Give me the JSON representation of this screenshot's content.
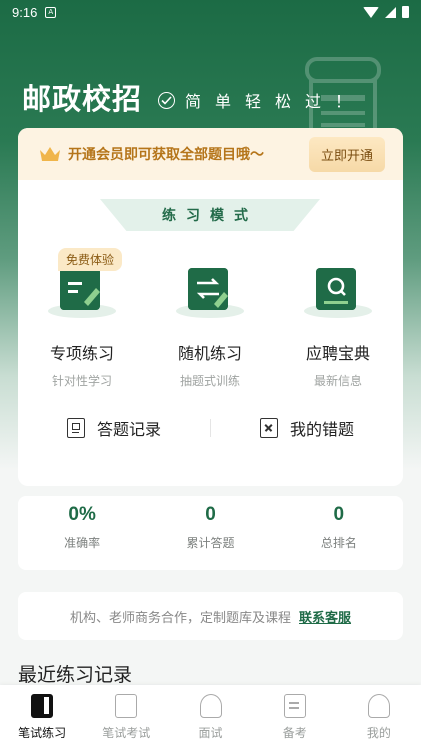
{
  "status_bar": {
    "time": "9:16",
    "notif": "A"
  },
  "header": {
    "brand": "邮政校招",
    "slogan": "简单轻松过！"
  },
  "vip_banner": {
    "text": "开通会员即可获取全部题目哦～",
    "button": "立即开通"
  },
  "practice": {
    "mode_title": "练习模式",
    "free_badge": "免费体验",
    "items": [
      {
        "title": "专项练习",
        "sub": "针对性学习",
        "icon": "pencil-note-icon"
      },
      {
        "title": "随机练习",
        "sub": "抽题式训练",
        "icon": "shuffle-icon"
      },
      {
        "title": "应聘宝典",
        "sub": "最新信息",
        "icon": "book-search-icon"
      }
    ],
    "links": [
      {
        "label": "答题记录",
        "icon": "record-icon"
      },
      {
        "label": "我的错题",
        "icon": "wrong-answers-icon"
      }
    ]
  },
  "stats": [
    {
      "value": "0%",
      "label": "准确率"
    },
    {
      "value": "0",
      "label": "累计答题"
    },
    {
      "value": "0",
      "label": "总排名"
    }
  ],
  "contact": {
    "text": "机构、老师商务合作，定制题库及课程",
    "link": "联系客服"
  },
  "recent": {
    "title": "最近练习记录"
  },
  "tabbar": [
    {
      "label": "笔试练习",
      "active": true
    },
    {
      "label": "笔试考试"
    },
    {
      "label": "面试"
    },
    {
      "label": "备考"
    },
    {
      "label": "我的"
    }
  ],
  "colors": {
    "primary": "#1f6b47",
    "vip_text": "#b5751a",
    "vip_bg": "#fdf3e2"
  }
}
